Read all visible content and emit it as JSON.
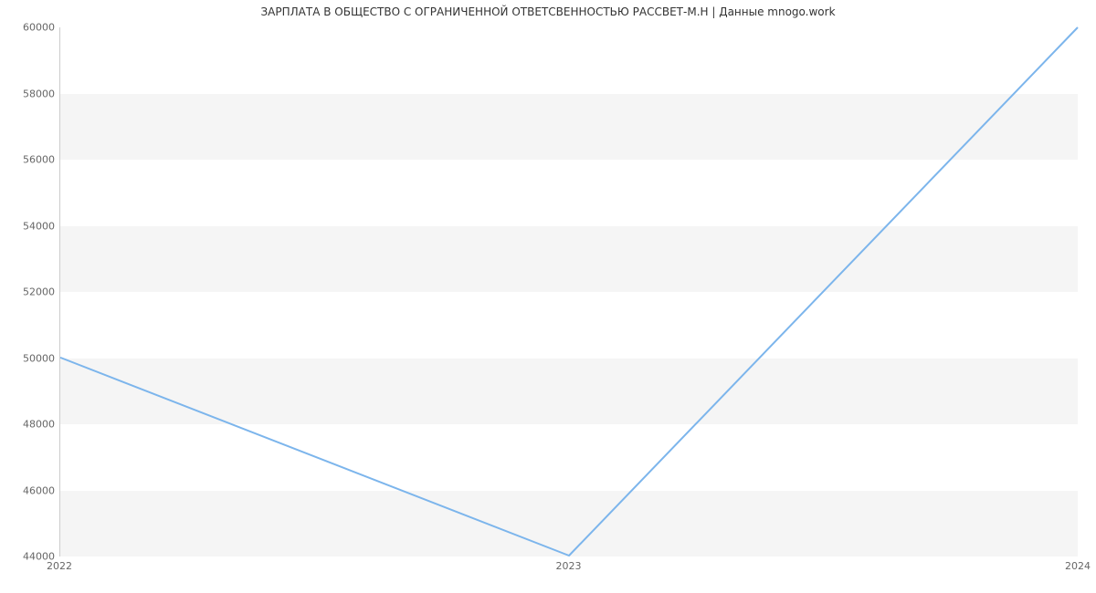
{
  "chart_data": {
    "type": "line",
    "title": "ЗАРПЛАТА В ОБЩЕСТВО С ОГРАНИЧЕННОЙ ОТВЕТСВЕННОСТЬЮ РАССВЕТ-М.Н | Данные mnogo.work",
    "x": [
      2022,
      2023,
      2024
    ],
    "values": [
      50000,
      44000,
      60000
    ],
    "xlabel": "",
    "ylabel": "",
    "xlim": [
      2022,
      2024
    ],
    "ylim": [
      44000,
      60000
    ],
    "x_ticks": [
      2022,
      2023,
      2024
    ],
    "y_ticks": [
      44000,
      46000,
      48000,
      50000,
      52000,
      54000,
      56000,
      58000,
      60000
    ],
    "line_color": "#7cb5ec",
    "band_color": "#f5f5f5"
  }
}
